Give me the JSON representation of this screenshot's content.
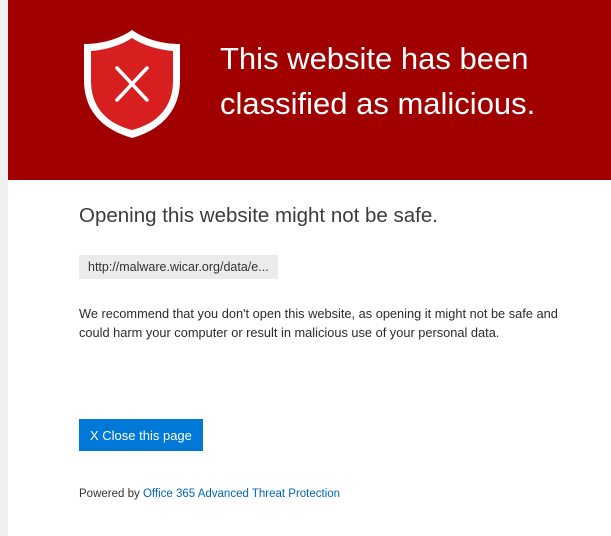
{
  "banner": {
    "title_line1": "This website has been",
    "title_line2": "classified as malicious.",
    "icon": "shield-x-icon",
    "background_color": "#a00000"
  },
  "main": {
    "subtitle": "Opening this website might not be safe.",
    "url": "http://malware.wicar.org/data/e...",
    "description": "We recommend that you don't open this website, as opening it might not be safe and could harm your computer or result in malicious use of your personal data.",
    "close_button_label": "X Close this page",
    "close_button_color": "#0078d7"
  },
  "footer": {
    "powered_by_prefix": "Powered by",
    "powered_by_link": "Office 365 Advanced Threat Protection",
    "link_color": "#0067b8"
  }
}
